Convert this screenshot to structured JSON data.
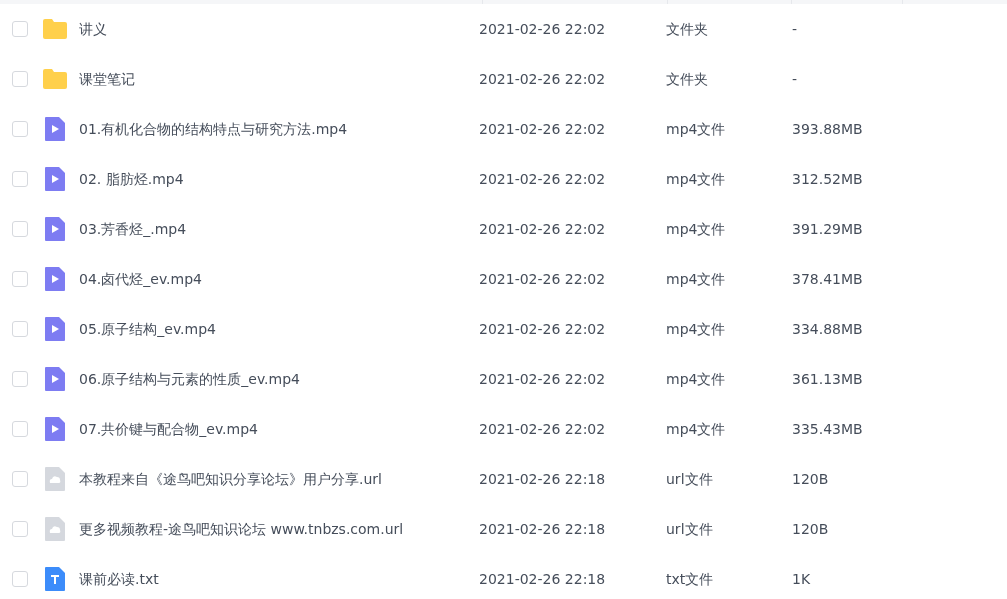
{
  "files": [
    {
      "kind": "folder",
      "name": "讲义",
      "modified": "2021-02-26 22:02",
      "type": "文件夹",
      "size": "-",
      "checked": false
    },
    {
      "kind": "folder",
      "name": "课堂笔记",
      "modified": "2021-02-26 22:02",
      "type": "文件夹",
      "size": "-",
      "checked": false
    },
    {
      "kind": "video",
      "name": "01.有机化合物的结构特点与研究方法.mp4",
      "modified": "2021-02-26 22:02",
      "type": "mp4文件",
      "size": "393.88MB",
      "checked": false
    },
    {
      "kind": "video",
      "name": "02. 脂肪烃.mp4",
      "modified": "2021-02-26 22:02",
      "type": "mp4文件",
      "size": "312.52MB",
      "checked": false
    },
    {
      "kind": "video",
      "name": "03.芳香烃_.mp4",
      "modified": "2021-02-26 22:02",
      "type": "mp4文件",
      "size": "391.29MB",
      "checked": false
    },
    {
      "kind": "video",
      "name": "04.卤代烃_ev.mp4",
      "modified": "2021-02-26 22:02",
      "type": "mp4文件",
      "size": "378.41MB",
      "checked": false
    },
    {
      "kind": "video",
      "name": "05.原子结构_ev.mp4",
      "modified": "2021-02-26 22:02",
      "type": "mp4文件",
      "size": "334.88MB",
      "checked": false
    },
    {
      "kind": "video",
      "name": "06.原子结构与元素的性质_ev.mp4",
      "modified": "2021-02-26 22:02",
      "type": "mp4文件",
      "size": "361.13MB",
      "checked": false
    },
    {
      "kind": "video",
      "name": "07.共价键与配合物_ev.mp4",
      "modified": "2021-02-26 22:02",
      "type": "mp4文件",
      "size": "335.43MB",
      "checked": false
    },
    {
      "kind": "link",
      "name": "本教程来自《途鸟吧知识分享论坛》用户分享.url",
      "modified": "2021-02-26 22:18",
      "type": "url文件",
      "size": "120B",
      "checked": false
    },
    {
      "kind": "link",
      "name": "更多视频教程-途鸟吧知识论坛 www.tnbzs.com.url",
      "modified": "2021-02-26 22:18",
      "type": "url文件",
      "size": "120B",
      "checked": false
    },
    {
      "kind": "text",
      "name": "课前必读.txt",
      "modified": "2021-02-26 22:18",
      "type": "txt文件",
      "size": "1K",
      "checked": false
    }
  ]
}
